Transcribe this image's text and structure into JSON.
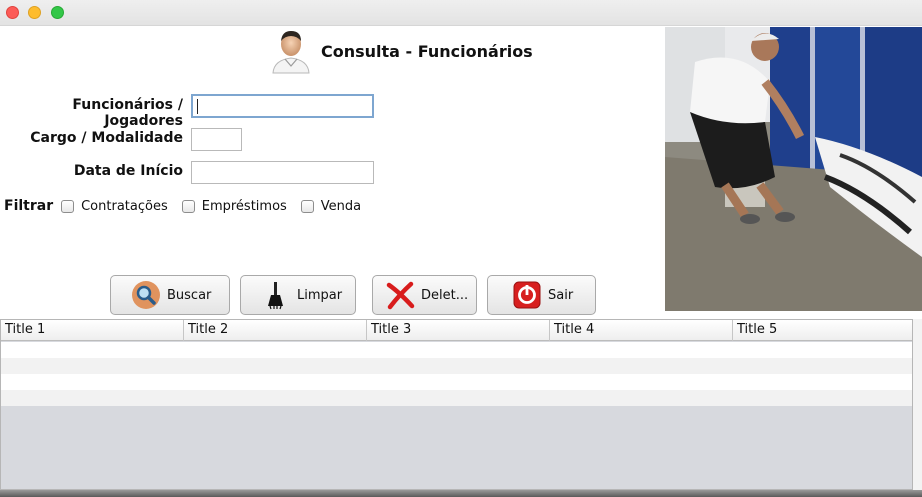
{
  "window": {
    "title": ""
  },
  "header": {
    "title": "Consulta - Funcionários",
    "icon": "person-icon"
  },
  "form": {
    "funcionarios_label": "Funcionários / Jogadores",
    "funcionarios_value": "",
    "cargo_label": "Cargo / Modalidade",
    "cargo_value": "",
    "data_label": "Data de Início",
    "data_value": ""
  },
  "filters": {
    "label": "Filtrar",
    "options": [
      {
        "label": "Contratações",
        "checked": false
      },
      {
        "label": "Empréstimos",
        "checked": false
      },
      {
        "label": "Venda",
        "checked": false
      }
    ]
  },
  "buttons": {
    "buscar": "Buscar",
    "limpar": "Limpar",
    "deletar": "Delet...",
    "sair": "Sair"
  },
  "table": {
    "columns": [
      "Title 1",
      "Title 2",
      "Title 3",
      "Title 4",
      "Title 5"
    ],
    "rows": [
      [
        "",
        "",
        "",
        "",
        ""
      ],
      [
        "",
        "",
        "",
        "",
        ""
      ],
      [
        "",
        "",
        "",
        "",
        ""
      ],
      [
        "",
        "",
        "",
        "",
        ""
      ]
    ]
  },
  "colors": {
    "accent_focus": "#7ea6d0",
    "table_bg": "#d7d9de",
    "close": "#fc5b57",
    "minimize": "#fdbc2e",
    "maximize": "#33c748"
  }
}
